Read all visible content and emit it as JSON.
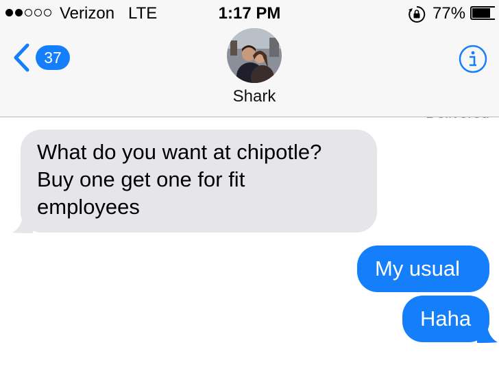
{
  "status_bar": {
    "signal_bars_filled": 2,
    "signal_bars_total": 5,
    "carrier": "Verizon",
    "network": "LTE",
    "time": "1:17 PM",
    "battery_percent": "77%",
    "battery_level": 0.77
  },
  "nav": {
    "back_count": "37",
    "contact_name": "Shark"
  },
  "conversation": {
    "delivered_label": "Delivered",
    "messages": [
      {
        "direction": "incoming",
        "text": "What do you want at chipotle?\nBuy one get one for fit\nemployees"
      },
      {
        "direction": "outgoing",
        "text": "My usual"
      },
      {
        "direction": "outgoing",
        "text": "Haha"
      }
    ]
  },
  "colors": {
    "accent_blue": "#157efb",
    "incoming_bubble": "#e5e5ea",
    "header_bg": "#f7f7f7"
  },
  "icons": {
    "back": "chevron-left-icon",
    "info": "info-icon",
    "orientation_lock": "orientation-lock-icon"
  }
}
